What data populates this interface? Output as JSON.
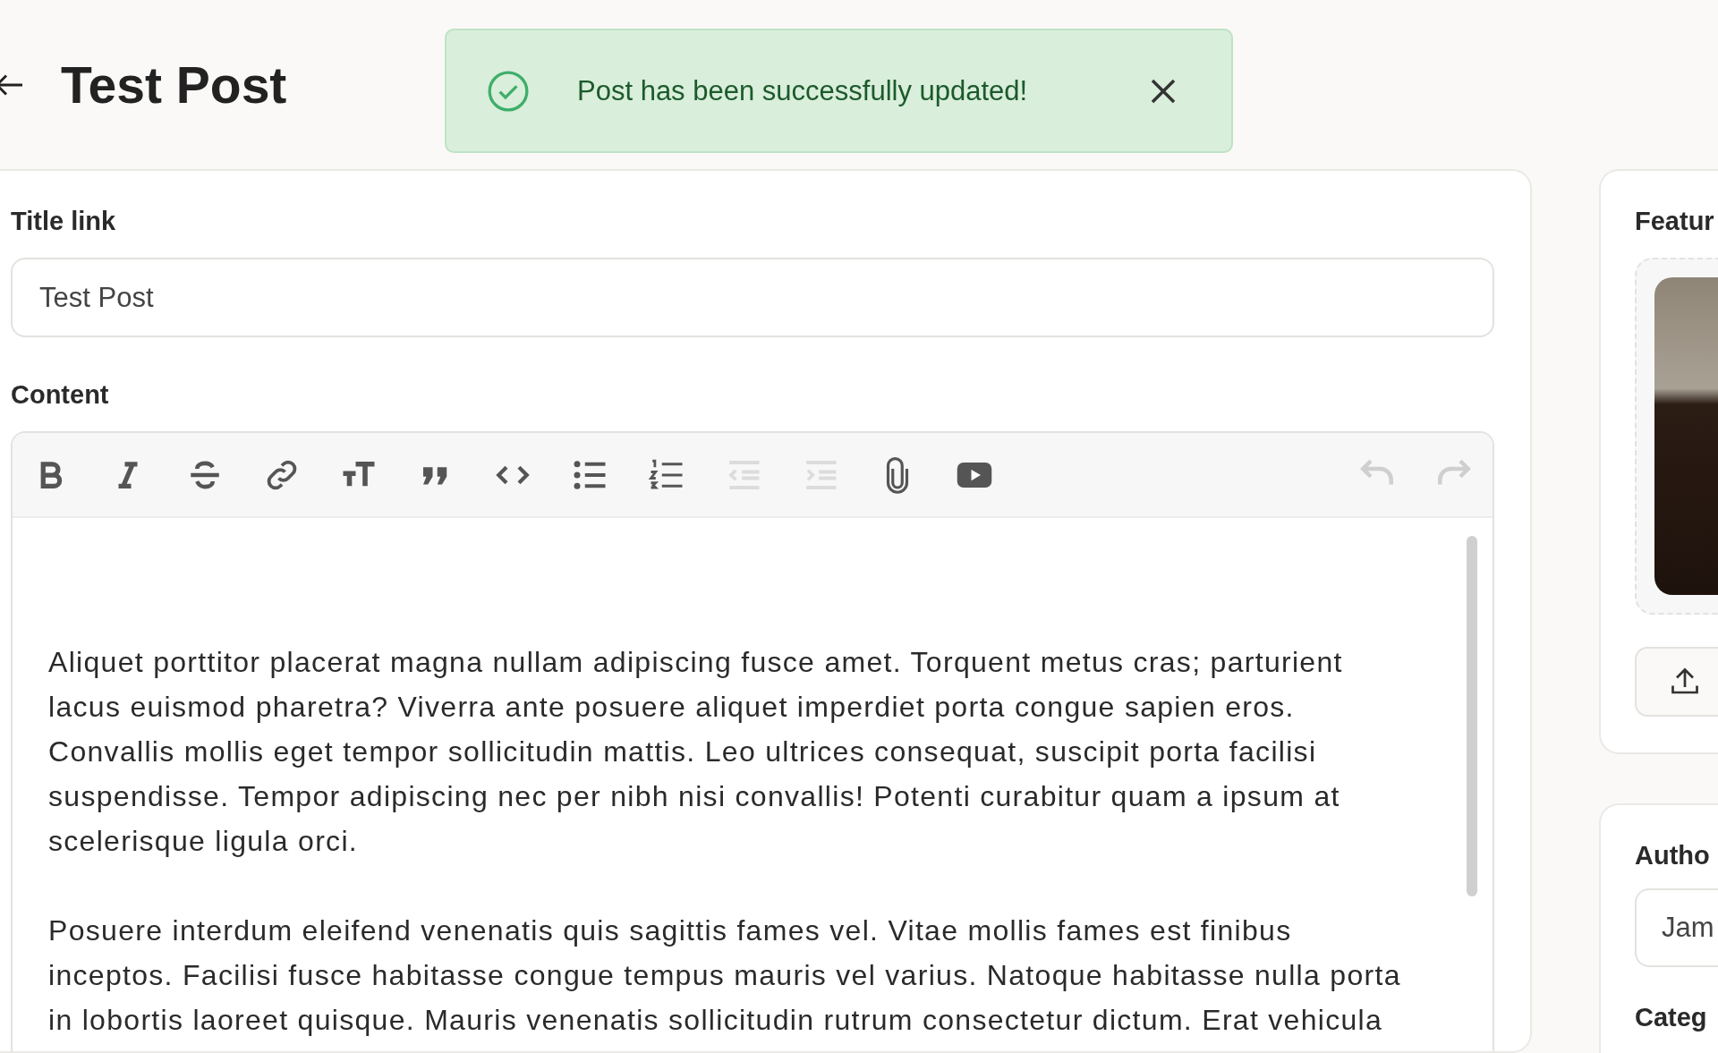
{
  "header": {
    "title": "Test Post"
  },
  "toast": {
    "message": "Post has been successfully updated!"
  },
  "form": {
    "title_field": {
      "label": "Title link",
      "value": "Test Post"
    },
    "content": {
      "label": "Content",
      "toolbar": [
        {
          "kind": "bold",
          "disabled": false
        },
        {
          "kind": "italic",
          "disabled": false
        },
        {
          "kind": "strike",
          "disabled": false
        },
        {
          "kind": "link",
          "disabled": false
        },
        {
          "kind": "heading",
          "disabled": false
        },
        {
          "kind": "quote",
          "disabled": false
        },
        {
          "kind": "code",
          "disabled": false
        },
        {
          "kind": "bullets",
          "disabled": false
        },
        {
          "kind": "numbers",
          "disabled": false
        },
        {
          "kind": "outdent",
          "disabled": true
        },
        {
          "kind": "indent",
          "disabled": true
        },
        {
          "kind": "attach",
          "disabled": false
        },
        {
          "kind": "video",
          "disabled": false
        },
        {
          "kind": "undo",
          "disabled": true
        },
        {
          "kind": "redo",
          "disabled": true
        }
      ],
      "paragraphs": [
        "Aliquet porttitor placerat magna nullam adipiscing fusce amet. Torquent metus cras; parturient lacus euismod pharetra? Viverra ante posuere aliquet imperdiet porta congue sapien eros. Convallis mollis eget tempor sollicitudin mattis. Leo ultrices consequat, suscipit porta facilisi suspendisse. Tempor adipiscing nec per nibh nisi convallis! Potenti curabitur quam a ipsum at scelerisque ligula orci.",
        "Posuere interdum eleifend venenatis quis sagittis fames vel. Vitae mollis fames est finibus inceptos. Facilisi fusce habitasse congue tempus mauris vel varius. Natoque habitasse nulla porta in lobortis laoreet quisque. Mauris venenatis sollicitudin rutrum consectetur dictum. Erat vehicula"
      ]
    }
  },
  "sidebar": {
    "featured": {
      "label": "Featur"
    },
    "author": {
      "label": "Autho",
      "value": "Jam"
    },
    "category": {
      "label": "Categ"
    }
  }
}
